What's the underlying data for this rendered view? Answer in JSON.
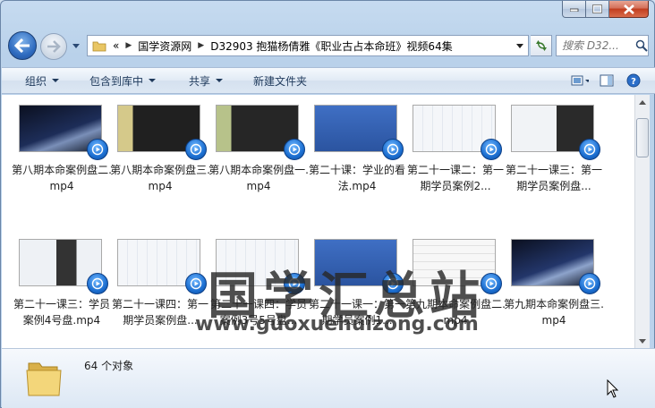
{
  "caption": {
    "minimize_icon": "minimize-icon",
    "maximize_icon": "maximize-icon",
    "close_icon": "close-icon"
  },
  "nav": {
    "breadcrumb_overflow": "«",
    "breadcrumb": [
      "国学资源网",
      "D32903  抱猫杨倩雅《职业古占本命班》视频64集"
    ],
    "search_placeholder": "搜索 D32..."
  },
  "commands": [
    {
      "label": "组织",
      "dropdown": true
    },
    {
      "label": "包含到库中",
      "dropdown": true
    },
    {
      "label": "共享",
      "dropdown": true
    },
    {
      "label": "新建文件夹",
      "dropdown": false
    }
  ],
  "files": [
    {
      "label": "第八期本命案例盘二.mp4",
      "thumb": "space"
    },
    {
      "label": "第八期本命案例盘三.mp4",
      "thumb": "dark-ui"
    },
    {
      "label": "第八期本命案例盘一.mp4",
      "thumb": "dark-ui-green"
    },
    {
      "label": "第二十课：学业的看法.mp4",
      "thumb": "blue-slide"
    },
    {
      "label": "第二十一课二：第一期学员案例2...",
      "thumb": "chart-white"
    },
    {
      "label": "第二十一课三：第一期学员案例盘...",
      "thumb": "chart-dark"
    },
    {
      "label": "第二十一课三：学员案例4号盘.mp4",
      "thumb": "chart-dark-2"
    },
    {
      "label": "第二十一课四：第一期学员案例盘...",
      "thumb": "chart-white"
    },
    {
      "label": "第二十一课四：学员案例3号5号盘...",
      "thumb": "chart-white"
    },
    {
      "label": "第二十一课一：第一期学员案例1...",
      "thumb": "blue-slide"
    },
    {
      "label": "第九期本命案例盘二.mp4",
      "thumb": "chart-white-2"
    },
    {
      "label": "第九期本命案例盘三.mp4",
      "thumb": "space-2"
    }
  ],
  "watermark": {
    "title": "国学汇总站",
    "url": "www.guoxuehuizong.com"
  },
  "details": {
    "count": "64 个对象"
  },
  "colors": {
    "accent": "#1c6fd1",
    "command_text": "#1e395b"
  }
}
